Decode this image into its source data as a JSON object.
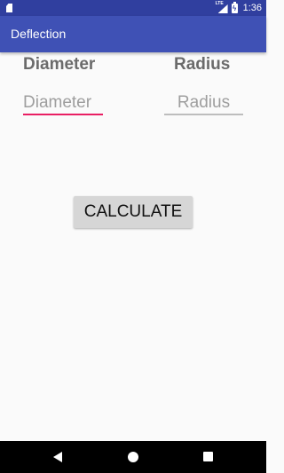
{
  "status_bar": {
    "network_label": "LTE",
    "time": "1:36",
    "icons": [
      "sd-card-icon",
      "lte-signal-icon",
      "battery-charging-icon"
    ]
  },
  "app_bar": {
    "title": "Deflection"
  },
  "form": {
    "diameter_label": "Diameter",
    "radius_label": "Radius",
    "diameter_input": {
      "value": "",
      "placeholder": "Diameter"
    },
    "radius_input": {
      "value": "",
      "placeholder": "Radius"
    },
    "calculate_label": "CALCULATE"
  },
  "navigation_bar": {
    "icons": [
      "back-icon",
      "home-icon",
      "recents-icon"
    ]
  },
  "colors": {
    "status_bar": "#303f9f",
    "app_bar": "#3f51b5",
    "focus_underline": "#e91e63",
    "button": "#d6d6d6"
  }
}
